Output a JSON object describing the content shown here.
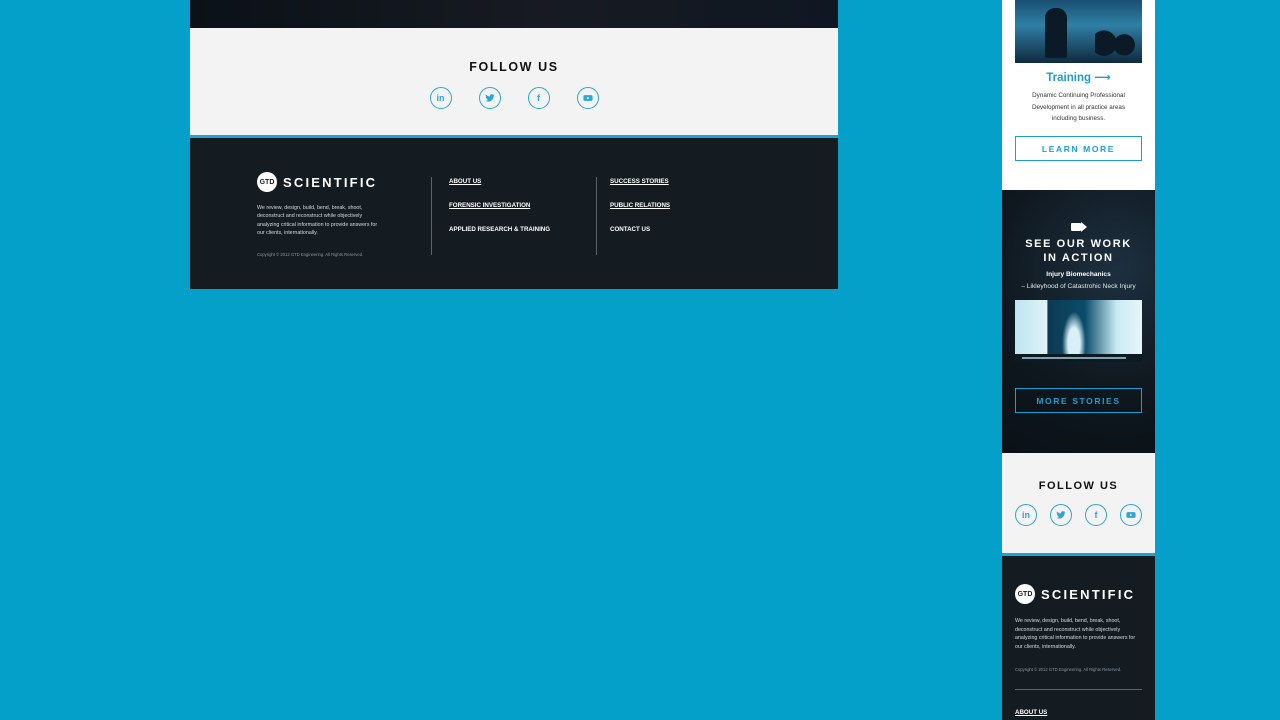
{
  "desktop": {
    "follow": {
      "title": "FOLLOW US",
      "icons": [
        "linkedin-icon",
        "twitter-icon",
        "facebook-icon",
        "youtube-icon"
      ]
    },
    "footer": {
      "logo_text": "SCIENTIFIC",
      "logo_badge": "GTD",
      "blurb": "We review, design, build, bend, break, shoot, deconstruct and reconstruct while objectively analyzing critical information to provide answers for our clients, internationally.",
      "copyright": "Copyright © 2012 GTD Engineering. All Rights Reserved.",
      "links_col1": [
        "ABOUT US",
        "FORENSIC INVESTIGATION",
        "APPLIED RESEARCH & TRAINING"
      ],
      "links_col2": [
        "SUCCESS STORIES",
        "PUBLIC RELATIONS",
        "CONTACT US"
      ]
    }
  },
  "mobile": {
    "training": {
      "title": "Training ⟶",
      "description": "Dynamic Continuing Professional Development in all practice areas including business.",
      "button": "LEARN MORE"
    },
    "video": {
      "title_line1": "SEE OUR WORK",
      "title_line2": "IN ACTION",
      "subtitle1": "Injury Biomechanics",
      "subtitle2": "– Likleyhood of Catastrohic Neck Injury",
      "button": "MORE STORIES"
    },
    "follow": {
      "title": "FOLLOW US"
    },
    "footer": {
      "logo_text": "SCIENTIFIC",
      "logo_badge": "GTD",
      "blurb": "We review, design, build, bend, break, shoot, deconstruct and reconstruct while objectively analyzing critical information to provide answers for our clients, internationally.",
      "copyright": "Copyright © 2012 GTD Engineering. All Rights Reserved.",
      "first_link": "ABOUT US"
    }
  },
  "colors": {
    "background": "#04a0c9",
    "accent": "#1b9ecd",
    "footer_bg": "#141c22",
    "follow_bg": "#f3f3f3"
  }
}
